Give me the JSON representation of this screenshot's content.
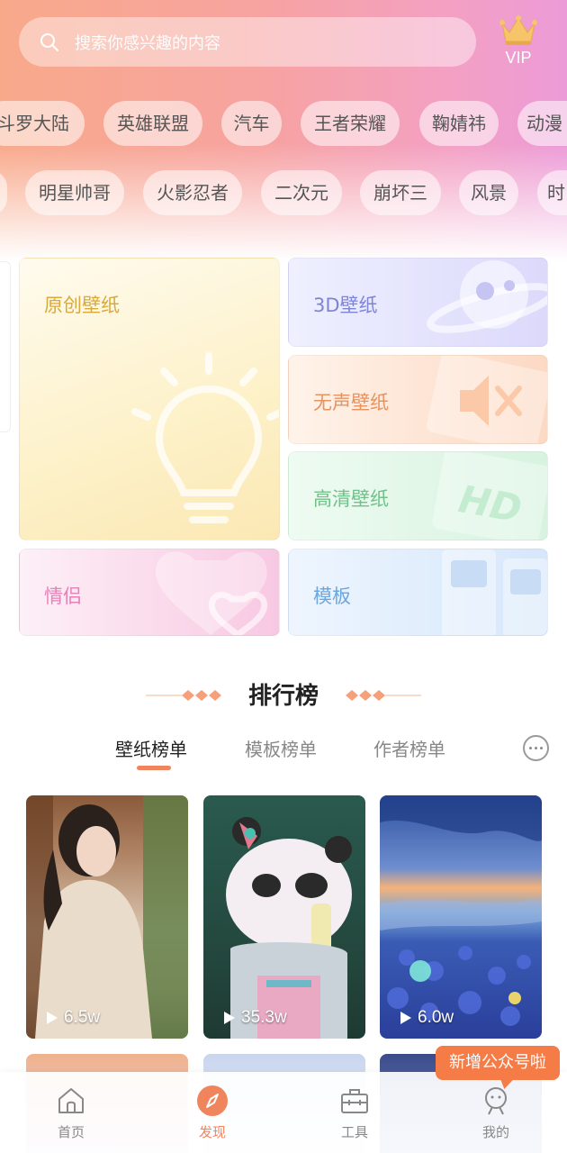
{
  "search": {
    "placeholder": "搜索你感兴趣的内容"
  },
  "vip": {
    "label": "VIP",
    "icon": "crown-icon"
  },
  "tags_row1": [
    "斗罗大陆",
    "英雄联盟",
    "汽车",
    "王者荣耀",
    "鞠婧祎",
    "动漫"
  ],
  "tags_row2": [
    "明星帅哥",
    "火影忍者",
    "二次元",
    "崩坏三",
    "风景",
    "时"
  ],
  "categories": {
    "original": "原创壁纸",
    "three_d": "3D壁纸",
    "silent": "无声壁纸",
    "hd": "高清壁纸",
    "couple": "情侣",
    "template": "模板"
  },
  "ranking": {
    "title": "排行榜",
    "tabs": [
      "壁纸榜单",
      "模板榜单",
      "作者榜单"
    ],
    "active_tab": "壁纸榜单",
    "items": [
      {
        "views": "6.5w"
      },
      {
        "views": "35.3w"
      },
      {
        "views": "6.0w"
      }
    ]
  },
  "tooltip": "新增公众号啦",
  "nav": {
    "items": [
      {
        "label": "首页",
        "icon": "home-icon"
      },
      {
        "label": "发现",
        "icon": "compass-icon"
      },
      {
        "label": "工具",
        "icon": "toolbox-icon"
      },
      {
        "label": "我的",
        "icon": "profile-icon"
      }
    ],
    "active": "发现"
  },
  "colors": {
    "accent": "#f0845c",
    "tooltip": "#f57b47"
  }
}
